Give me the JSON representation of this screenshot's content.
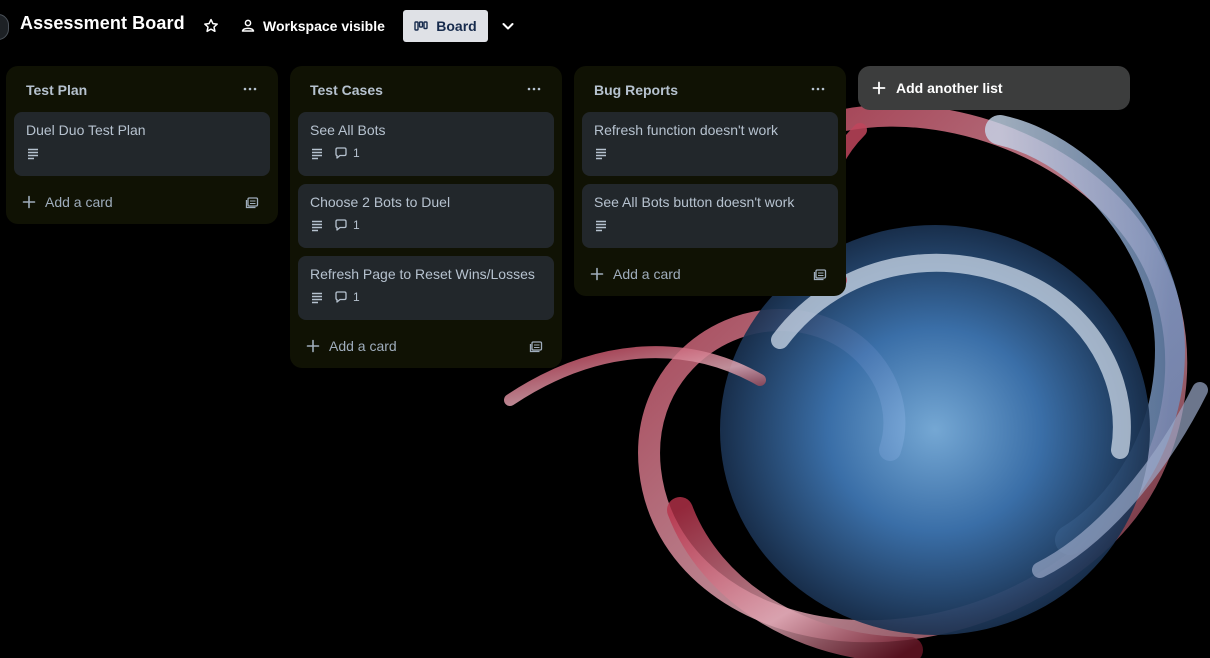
{
  "header": {
    "board_title": "Assessment Board",
    "visibility_label": "Workspace visible",
    "view_label": "Board"
  },
  "lists": [
    {
      "title": "Test Plan",
      "cards": [
        {
          "title": "Duel Duo Test Plan",
          "has_description": true,
          "comments": null
        }
      ],
      "add_card_label": "Add a card"
    },
    {
      "title": "Test Cases",
      "cards": [
        {
          "title": "See All Bots",
          "has_description": true,
          "comments": "1"
        },
        {
          "title": "Choose 2 Bots to Duel",
          "has_description": true,
          "comments": "1"
        },
        {
          "title": "Refresh Page to Reset Wins/Losses",
          "has_description": true,
          "comments": "1"
        }
      ],
      "add_card_label": "Add a card"
    },
    {
      "title": "Bug Reports",
      "cards": [
        {
          "title": "Refresh function doesn't work",
          "has_description": true,
          "comments": null
        },
        {
          "title": "See All Bots button doesn't work",
          "has_description": true,
          "comments": null
        }
      ],
      "add_card_label": "Add a card"
    }
  ],
  "add_list_label": "Add another list",
  "colors": {
    "list_bg": "#101204",
    "card_bg": "#22272b",
    "text": "#b6c2cf",
    "view_button_bg": "#dfe1e6"
  }
}
